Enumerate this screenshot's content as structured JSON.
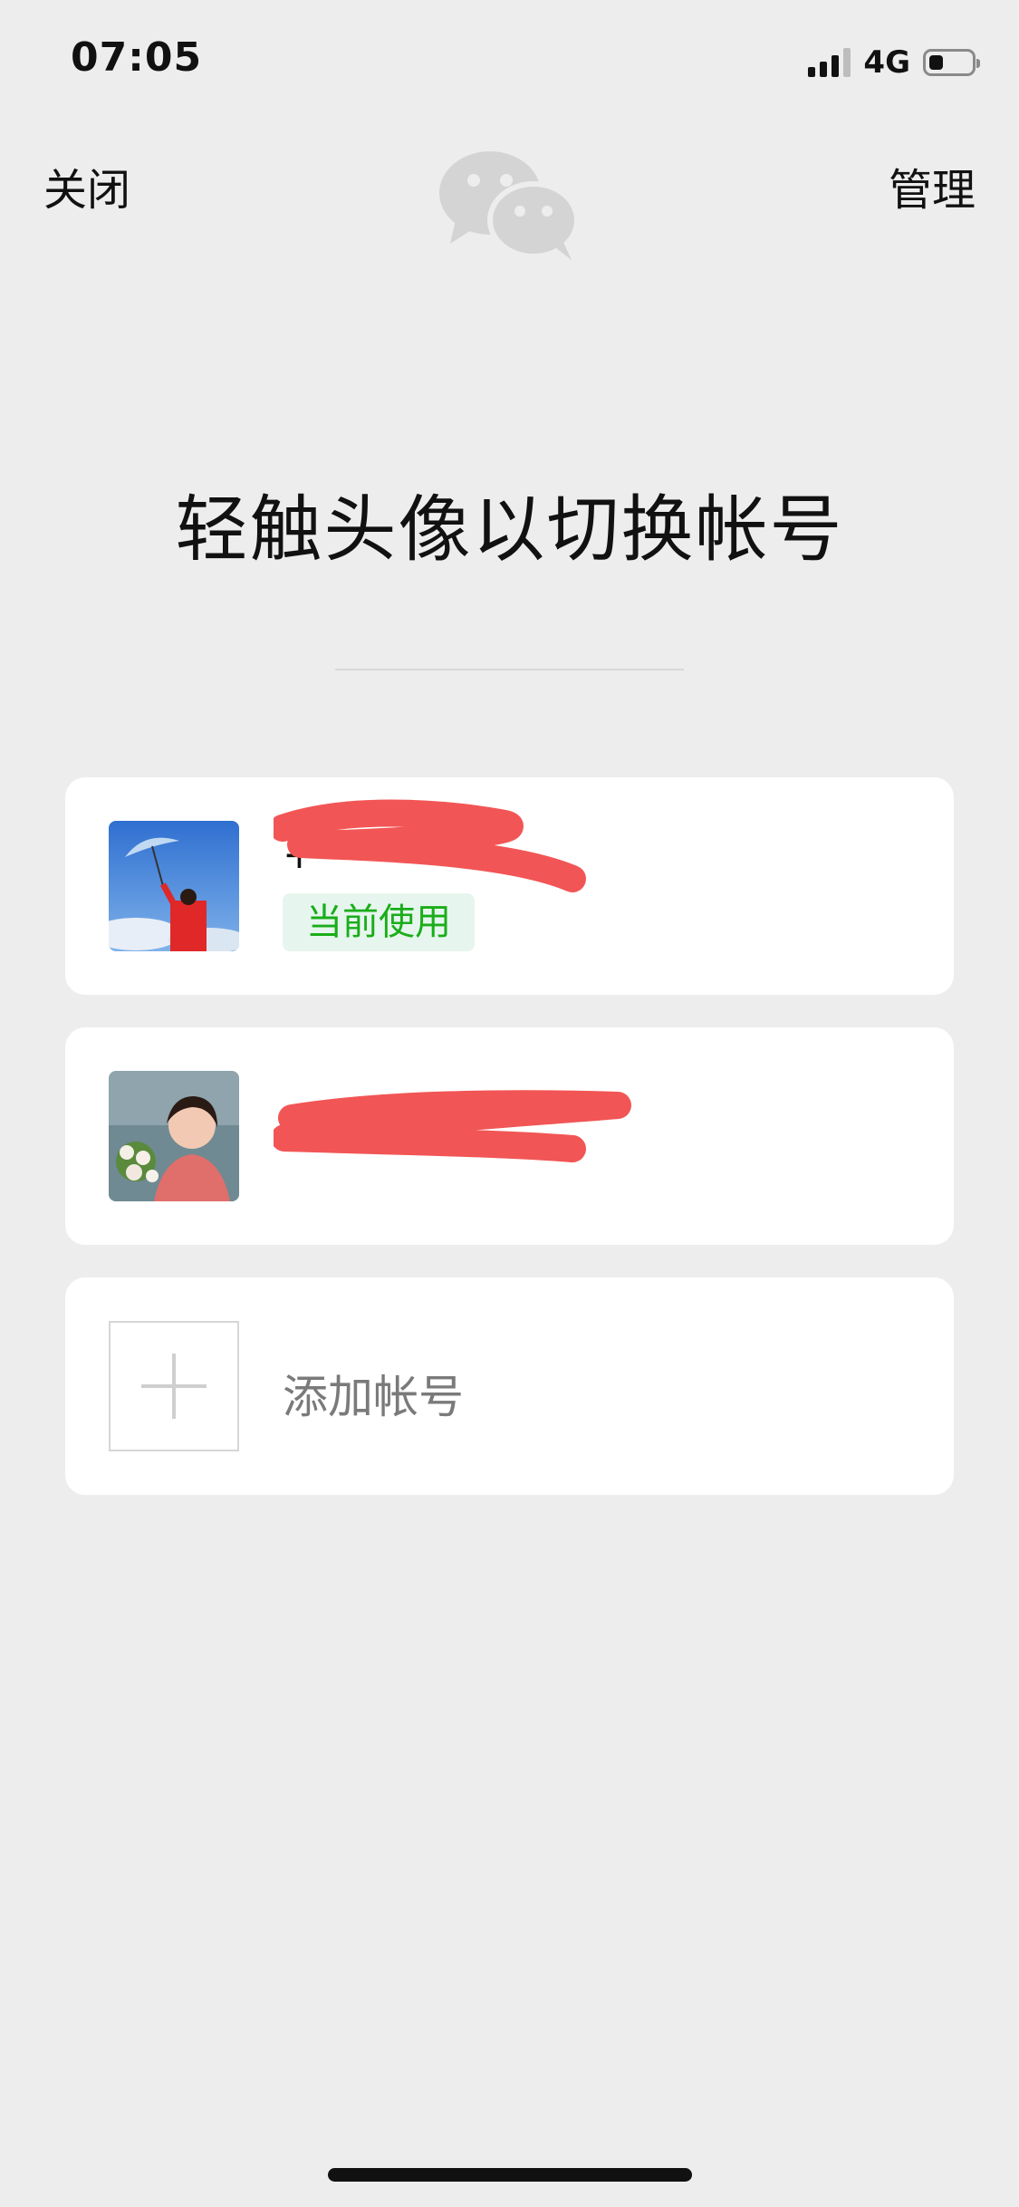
{
  "status_bar": {
    "time": "07:05",
    "network": "4G",
    "battery_level": 0.35
  },
  "header": {
    "close_label": "关闭",
    "manage_label": "管理",
    "logo_icon": "wechat-logo-icon"
  },
  "title": "轻触头像以切换帐号",
  "accounts": [
    {
      "name": "+",
      "badge": "当前使用",
      "avatar_icon": "avatar-umbrella-photo",
      "redacted": true
    },
    {
      "name": "x",
      "avatar_icon": "avatar-woman-flowers-photo",
      "redacted": true
    }
  ],
  "add_account": {
    "label": "添加帐号",
    "icon": "plus-icon"
  },
  "colors": {
    "background": "#ededed",
    "card": "#ffffff",
    "badge_text": "#1aad19",
    "badge_bg": "#e6f6ee",
    "redaction": "#f25555"
  }
}
